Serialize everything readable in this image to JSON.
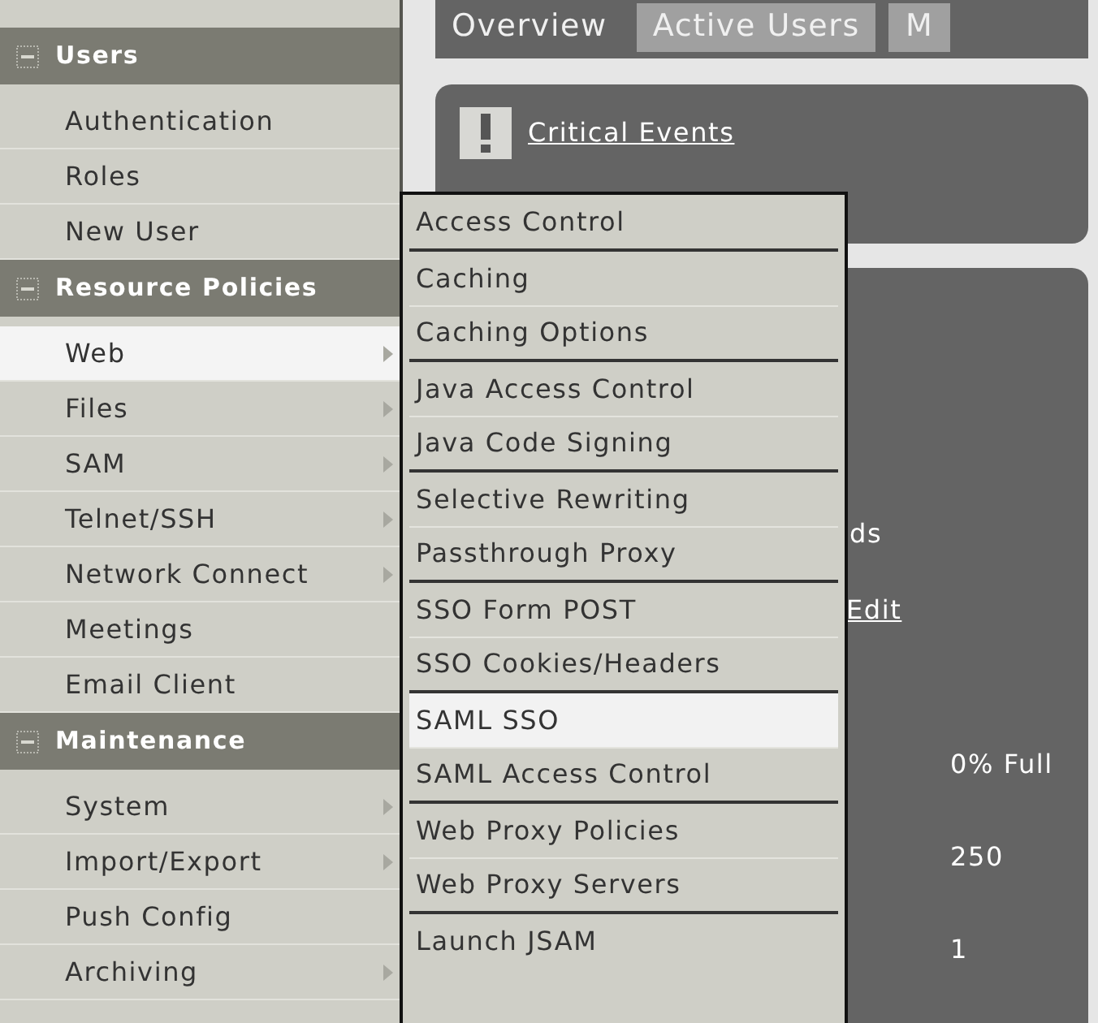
{
  "sidebar": {
    "sections": [
      {
        "title": "Users",
        "items": [
          {
            "label": "Authentication",
            "arrow": false,
            "selected": false
          },
          {
            "label": "Roles",
            "arrow": false,
            "selected": false
          },
          {
            "label": "New User",
            "arrow": false,
            "selected": false
          }
        ]
      },
      {
        "title": "Resource Policies",
        "items": [
          {
            "label": "Web",
            "arrow": true,
            "selected": true
          },
          {
            "label": "Files",
            "arrow": true,
            "selected": false
          },
          {
            "label": "SAM",
            "arrow": true,
            "selected": false
          },
          {
            "label": "Telnet/SSH",
            "arrow": true,
            "selected": false
          },
          {
            "label": "Network Connect",
            "arrow": true,
            "selected": false
          },
          {
            "label": "Meetings",
            "arrow": false,
            "selected": false
          },
          {
            "label": "Email Client",
            "arrow": false,
            "selected": false
          }
        ]
      },
      {
        "title": "Maintenance",
        "items": [
          {
            "label": "System",
            "arrow": true,
            "selected": false
          },
          {
            "label": "Import/Export",
            "arrow": true,
            "selected": false
          },
          {
            "label": "Push Config",
            "arrow": false,
            "selected": false
          },
          {
            "label": "Archiving",
            "arrow": true,
            "selected": false
          }
        ]
      }
    ]
  },
  "tabs": [
    {
      "label": "Overview",
      "selected": true
    },
    {
      "label": "Active Users",
      "selected": false
    },
    {
      "label": "M",
      "selected": false
    }
  ],
  "critical_events": {
    "label": "Critical Events"
  },
  "panel_texts": [
    {
      "text": "ds",
      "kind": "text"
    },
    {
      "text": "Edit",
      "kind": "link"
    },
    {
      "text": "0% Full",
      "kind": "value"
    },
    {
      "text": "250",
      "kind": "value"
    },
    {
      "text": "1",
      "kind": "value"
    }
  ],
  "submenu": {
    "groups": [
      [
        {
          "label": "Access Control",
          "selected": false
        }
      ],
      [
        {
          "label": "Caching",
          "selected": false
        },
        {
          "label": "Caching Options",
          "selected": false
        }
      ],
      [
        {
          "label": "Java Access Control",
          "selected": false
        },
        {
          "label": "Java Code Signing",
          "selected": false
        }
      ],
      [
        {
          "label": "Selective Rewriting",
          "selected": false
        },
        {
          "label": "Passthrough Proxy",
          "selected": false
        }
      ],
      [
        {
          "label": "SSO Form POST",
          "selected": false
        },
        {
          "label": "SSO Cookies/Headers",
          "selected": false
        }
      ],
      [
        {
          "label": "SAML SSO",
          "selected": true
        },
        {
          "label": "SAML Access Control",
          "selected": false
        }
      ],
      [
        {
          "label": "Web Proxy Policies",
          "selected": false
        },
        {
          "label": "Web Proxy Servers",
          "selected": false
        }
      ],
      [
        {
          "label": "Launch JSAM",
          "selected": false
        }
      ]
    ]
  }
}
